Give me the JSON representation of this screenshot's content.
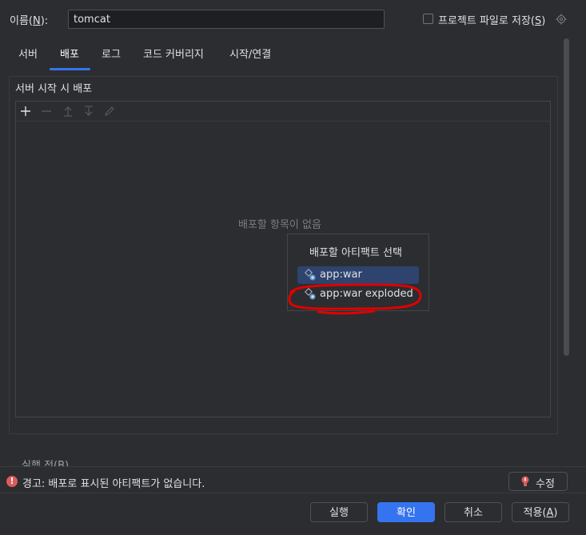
{
  "top": {
    "name_label": "이름(N):",
    "name_value": "tomcat",
    "save_label": "프로젝트 파일로 저장(S)"
  },
  "tabs": [
    {
      "label": "서버",
      "active": false
    },
    {
      "label": "배포",
      "active": true
    },
    {
      "label": "로그",
      "active": false
    },
    {
      "label": "코드 커버리지",
      "active": false
    },
    {
      "label": "시작/연결",
      "active": false
    }
  ],
  "deploy": {
    "section_title": "서버 시작 시 배포",
    "toolbar_icons": [
      "plus-icon",
      "minus-icon",
      "move-up-icon",
      "move-down-icon",
      "edit-icon"
    ],
    "empty_text": "배포할 항목이 없음"
  },
  "popup": {
    "title": "배포할 아티팩트 선택",
    "items": [
      {
        "label": "app:war",
        "icon": "artifact-icon",
        "selected": true
      },
      {
        "label": "app:war exploded",
        "icon": "artifact-icon",
        "selected": false
      }
    ]
  },
  "before_launch": "실행 전(B)",
  "warning": {
    "text": "경고: 배포로 표시된 아티팩트가 없습니다.",
    "fix_label": "수정"
  },
  "buttons": {
    "run": "실행",
    "ok": "확인",
    "cancel": "취소",
    "apply": "적용(A)"
  },
  "colors": {
    "background": "#2b2d30",
    "accent": "#3574f0",
    "selection": "#2e436e",
    "error": "#db5c5c",
    "annotation": "#e00000"
  }
}
